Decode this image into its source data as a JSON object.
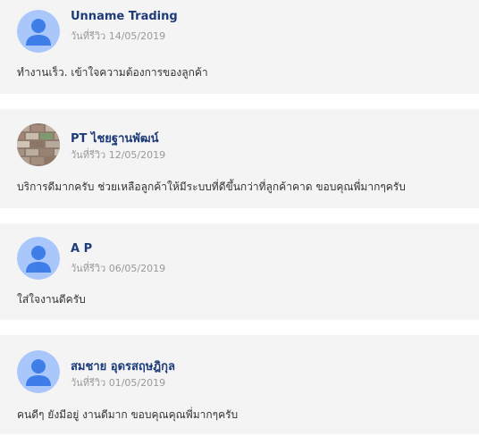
{
  "reviews": [
    {
      "name": "Unname Trading",
      "date": "วันที่รีวิว 14/05/2019",
      "text": "ทำงานเร็ว. เข้าใจความต้องการของลูกค้า",
      "avatar": "default-user-icon"
    },
    {
      "name": "PT ไชยฐานพัฒน์",
      "date": "วันที่รีวิว 12/05/2019",
      "text": "บริการดีมากครับ ช่วยเหลือลูกค้าให้มีระบบที่ดีขึ้นกว่าที่ลูกค้าคาด ขอบคุณพี่มากๆครับ",
      "avatar": "brick-wall-photo"
    },
    {
      "name": "A P",
      "date": "วันที่รีวิว 06/05/2019",
      "text": "ใส่ใจงานดีครับ",
      "avatar": "default-user-icon"
    },
    {
      "name": "สมชาย อุดรสฤษฎิกุล",
      "date": "วันที่รีวิว 01/05/2019",
      "text": "คนดีๆ ยังมีอยู่ งานดีมาก ขอบคุณคุณพี่มากๆครับ",
      "avatar": "default-user-icon"
    }
  ],
  "colors": {
    "card_bg": "#f4f4f4",
    "name": "#1d3b78",
    "date": "#999999",
    "text": "#333333",
    "avatar_bg": "#a9c7fb",
    "avatar_fg": "#3f7ee8"
  }
}
